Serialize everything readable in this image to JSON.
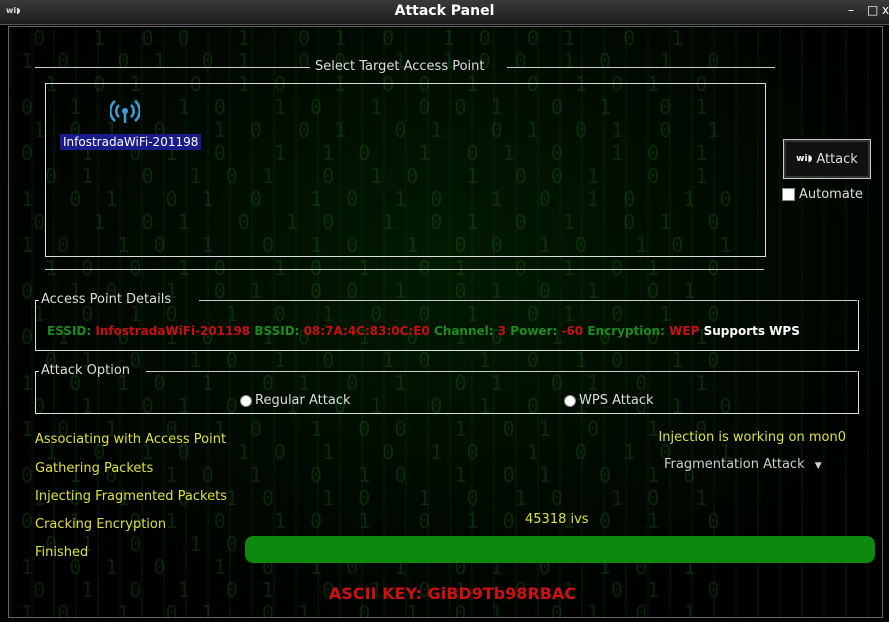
{
  "window": {
    "title": "Attack Panel",
    "app_icon_text": "wi◗",
    "minimize": "–",
    "maximize": "□",
    "close": "x"
  },
  "target": {
    "legend": "Select Target Access Point",
    "ap_name": "InfostradaWiFi-201198",
    "icon": "wifi-signal-icon"
  },
  "attack_button": {
    "label": "Attack",
    "icon_text": "wi◗"
  },
  "automate": {
    "label": "Automate",
    "checked": false
  },
  "details": {
    "legend": "Access Point Details",
    "essid_label": "ESSID:",
    "essid": "InfostradaWiFi-201198",
    "bssid_label": "BSSID:",
    "bssid": "08:7A:4C:83:0C:E0",
    "channel_label": "Channel:",
    "channel": "3",
    "power_label": "Power:",
    "power": "-60",
    "encryption_label": "Encryption:",
    "encryption": "WEP",
    "wps": "Supports WPS"
  },
  "attack_option": {
    "legend": "Attack Option",
    "regular": "Regular Attack",
    "wps": "WPS  Attack"
  },
  "status": {
    "associating": "Associating with Access Point",
    "gathering": "Gathering Packets",
    "injecting": "Injecting Fragmented Packets",
    "cracking": "Cracking Encryption",
    "finished": "Finished",
    "injection": "Injection is working on mon0",
    "attack_type": "Fragmentation Attack",
    "ivs": "45318 ivs",
    "progress": 1.0
  },
  "key": "ASCII KEY: GiBD9Tb98RBAC",
  "colors": {
    "label": "#1f8a1f",
    "value": "#c81010",
    "status": "#e0e040",
    "progress": "#0d8a0d"
  }
}
